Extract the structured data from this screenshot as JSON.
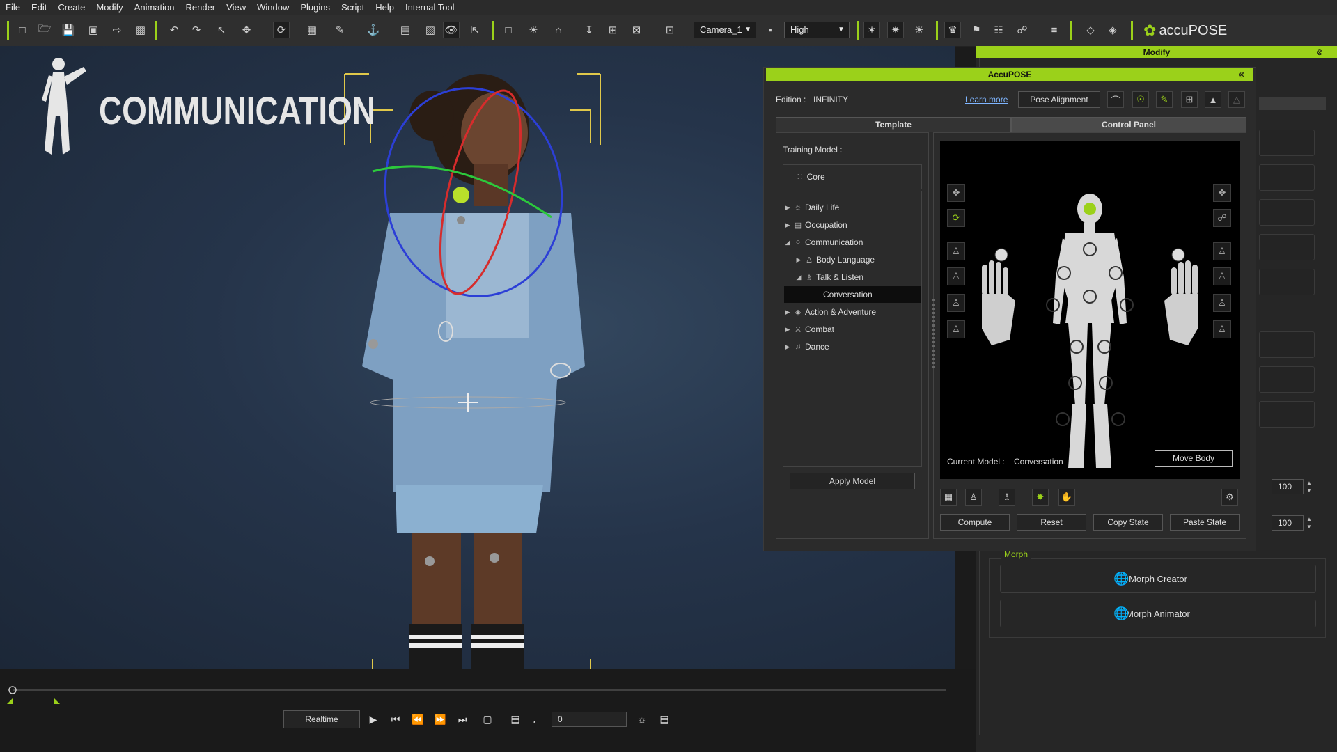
{
  "menu": [
    "File",
    "Edit",
    "Create",
    "Modify",
    "Animation",
    "Render",
    "View",
    "Window",
    "Plugins",
    "Script",
    "Help",
    "Internal Tool"
  ],
  "toolbar": {
    "camera_select": "Camera_1",
    "quality_select": "High",
    "brand": "accuPOSE",
    "accent": "#9bd11a"
  },
  "viewport": {
    "title": "COMMUNICATION"
  },
  "right_panel": {
    "header": "Modify",
    "field_values": [
      "100",
      "100"
    ],
    "morph_section": "Morph",
    "morph_creator": "Morph Creator",
    "morph_animator": "Morph Animator"
  },
  "dialog": {
    "title": "AccuPOSE",
    "edition_label": "Edition :",
    "edition_value": "INFINITY",
    "learn_more": "Learn more",
    "pose_alignment": "Pose Alignment",
    "tab_template": "Template",
    "tab_control": "Control Panel",
    "training_label": "Training Model :",
    "core_label": "Core",
    "tree": [
      {
        "label": "Daily Life",
        "level": 0,
        "expand": "collapsed"
      },
      {
        "label": "Occupation",
        "level": 0,
        "expand": "collapsed"
      },
      {
        "label": "Communication",
        "level": 0,
        "expand": "expanded"
      },
      {
        "label": "Body Language",
        "level": 1,
        "expand": "collapsed"
      },
      {
        "label": "Talk & Listen",
        "level": 1,
        "expand": "expanded"
      },
      {
        "label": "Conversation",
        "level": 2,
        "expand": "none"
      },
      {
        "label": "Action & Adventure",
        "level": 0,
        "expand": "collapsed"
      },
      {
        "label": "Combat",
        "level": 0,
        "expand": "collapsed"
      },
      {
        "label": "Dance",
        "level": 0,
        "expand": "collapsed"
      }
    ],
    "apply_model": "Apply Model",
    "current_model_label": "Current Model :",
    "current_model_value": "Conversation",
    "move_body": "Move Body",
    "compute": "Compute",
    "reset": "Reset",
    "copy_state": "Copy State",
    "paste_state": "Paste State"
  },
  "timeline": {
    "realtime": "Realtime",
    "frame": "0"
  }
}
